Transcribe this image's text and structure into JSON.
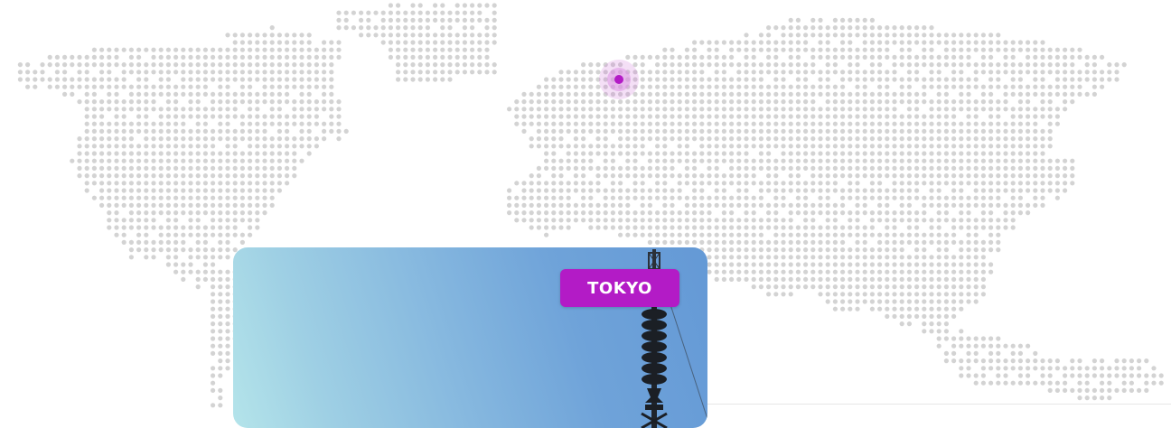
{
  "map": {
    "dot_color": "#d3d3d3",
    "pin_color": "#b31bc6"
  },
  "card": {
    "city_label": "TOKYO",
    "badge_color": "#b31bc6",
    "photo_subject": "tower"
  }
}
